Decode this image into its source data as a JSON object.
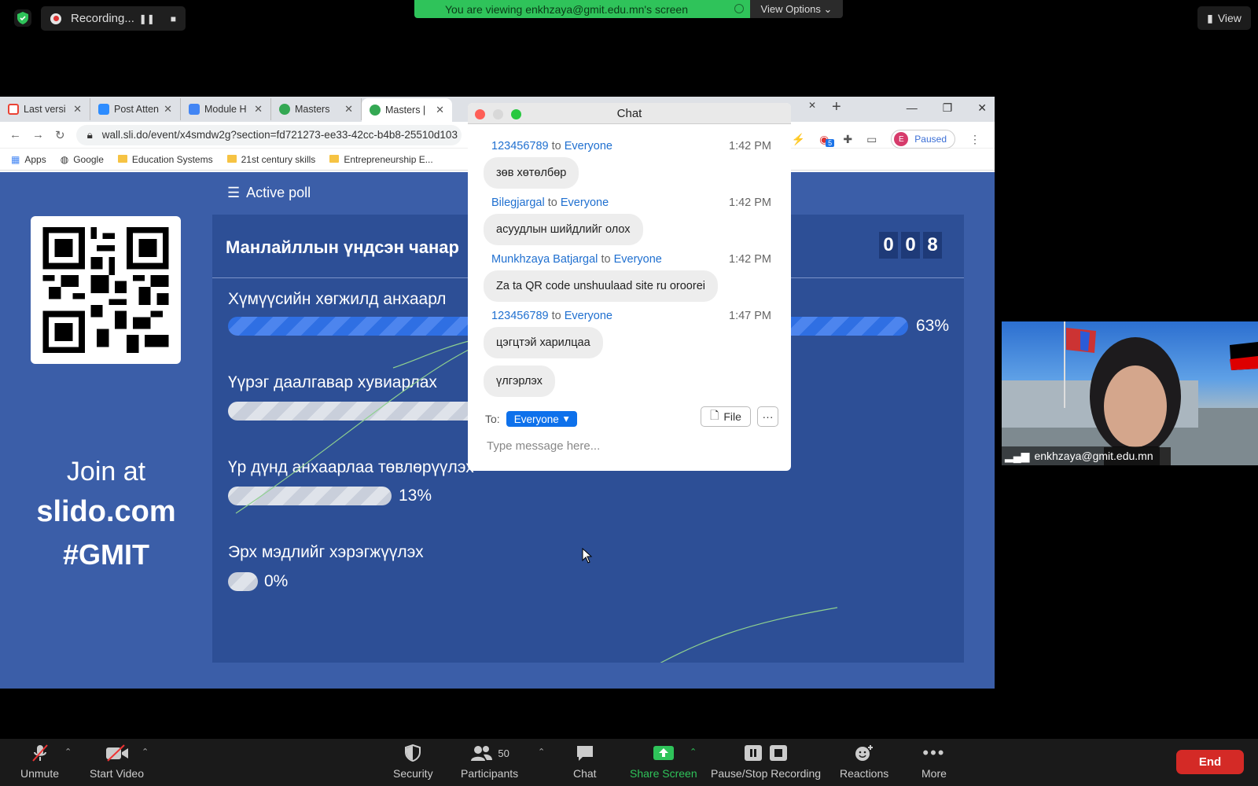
{
  "zoom_top": {
    "recording_label": "Recording...",
    "banner_text": "You are viewing enkhzaya@gmit.edu.mn's screen",
    "view_options": "View Options",
    "view_label": "View"
  },
  "browser": {
    "tabs": [
      {
        "label": "Last versi",
        "color": "#ea4335"
      },
      {
        "label": "Post Atten",
        "color": "#2d8cff"
      },
      {
        "label": "Module H",
        "color": "#4285f4"
      },
      {
        "label": "Masters",
        "color": "#34a853"
      },
      {
        "label": "Masters |",
        "color": "#34a853"
      }
    ],
    "url": "wall.sli.do/event/x4smdw2g?section=fd721273-ee33-42cc-b4b8-25510d103",
    "bookmarks": [
      "Apps",
      "Google",
      "Education Systems",
      "21st century skills",
      "Entrepreneurship E..."
    ],
    "profile_status": "Paused",
    "profile_initial": "E",
    "ext_badge": "5"
  },
  "slido": {
    "active_poll": "Active poll",
    "question": "Манлайллын үндсэн чанар",
    "counter": [
      "0",
      "0",
      "8"
    ],
    "options": [
      {
        "label": "Хүмүүсийн хөгжилд анхаарл",
        "percent": "63%",
        "fraction": 1.0
      },
      {
        "label": "Үүрэг даалгавар хувиарлах",
        "percent": "",
        "fraction": 0.62
      },
      {
        "label": "Үр дүнд анхаарлаа төвлөрүүлэх",
        "percent": "13%",
        "fraction": 0.24
      },
      {
        "label": "Эрх мэдлийг хэрэгжүүлэх",
        "percent": "0%",
        "fraction": 0.0
      }
    ],
    "join_at": "Join at",
    "join_site": "slido.com",
    "join_code": "#GMIT"
  },
  "chat": {
    "title": "Chat",
    "messages": [
      {
        "sender": "123456789",
        "to": "to",
        "recipient": "Everyone",
        "time": "1:42 PM",
        "text": "зөв хөтөлбөр"
      },
      {
        "sender": "Bilegjargal",
        "to": "to",
        "recipient": "Everyone",
        "time": "1:42 PM",
        "text": "асуудлын шийдлийг олох"
      },
      {
        "sender": "Munkhzaya Batjargal",
        "to": "to",
        "recipient": "Everyone",
        "time": "1:42 PM",
        "text": "Za ta QR code unshuulaad site ru oroorei"
      },
      {
        "sender": "123456789",
        "to": "to",
        "recipient": "Everyone",
        "time": "1:47 PM",
        "text": "цэгцтэй харилцаа"
      }
    ],
    "extra_message": "үлгэрлэх",
    "to_label": "To:",
    "to_value": "Everyone",
    "file_label": "File",
    "more_label": "···",
    "placeholder": "Type message here..."
  },
  "video": {
    "participant_name": "enkhzaya@gmit.edu.mn"
  },
  "toolbar": {
    "unmute": "Unmute",
    "start_video": "Start Video",
    "security": "Security",
    "participants": "Participants",
    "participant_count": "50",
    "chat": "Chat",
    "share_screen": "Share Screen",
    "pause_stop": "Pause/Stop Recording",
    "reactions": "Reactions",
    "more": "More",
    "end": "End"
  },
  "colors": {
    "share_green": "#2fc35a",
    "slido_blue": "#3b5ea8",
    "end_red": "#d42a26",
    "zoom_blue": "#0e71eb"
  }
}
